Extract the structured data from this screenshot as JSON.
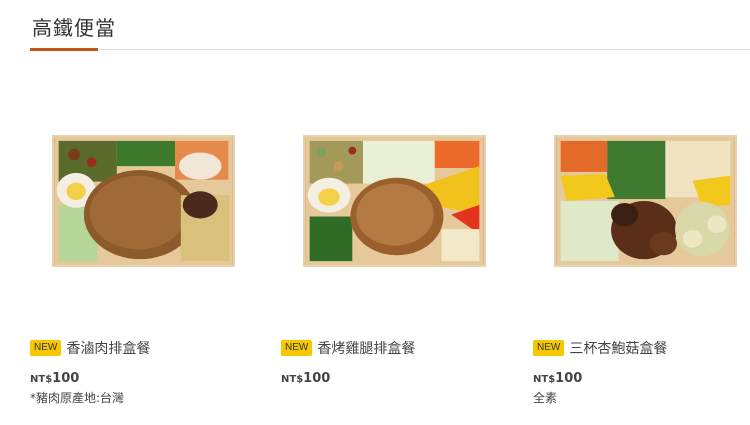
{
  "page": {
    "title": "高鐵便當"
  },
  "products": [
    {
      "badge": "NEW",
      "name": "香滷肉排盒餐",
      "currency": "NT$",
      "price": "100",
      "note": "*豬肉原產地:台灣"
    },
    {
      "badge": "NEW",
      "name": "香烤雞腿排盒餐",
      "currency": "NT$",
      "price": "100",
      "note": ""
    },
    {
      "badge": "NEW",
      "name": "三杯杏鮑菇盒餐",
      "currency": "NT$",
      "price": "100",
      "note": "全素"
    }
  ],
  "colors": {
    "accent": "#c0561b",
    "badge": "#f7c800",
    "divider": "#dcdcdc"
  }
}
